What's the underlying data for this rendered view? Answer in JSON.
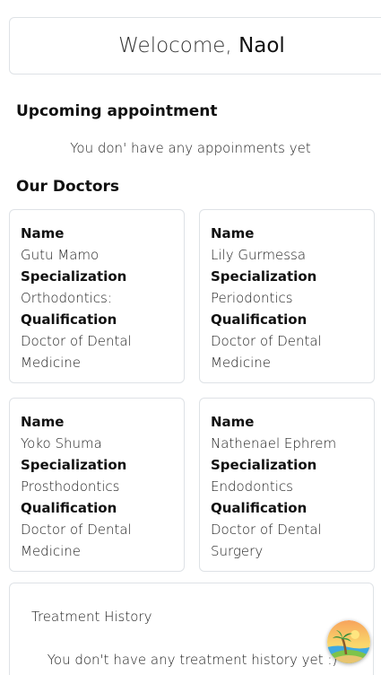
{
  "welcome": {
    "prefix": "Welocome,",
    "name": "Naol"
  },
  "appointments": {
    "heading": "Upcoming appointment",
    "empty_message": "You don' have any appoinments yet"
  },
  "doctors": {
    "heading": "Our Doctors",
    "labels": {
      "name": "Name",
      "specialization": "Specialization",
      "qualification": "Qualification"
    },
    "items": [
      {
        "name": "Gutu Mamo",
        "specialization": "Orthodontics:",
        "qualification_line1": "Doctor of Dental",
        "qualification_line2": "Medicine"
      },
      {
        "name": "Lily Gurmessa",
        "specialization": "Periodontics",
        "qualification_line1": "Doctor of Dental",
        "qualification_line2": "Medicine"
      },
      {
        "name": "Yoko Shuma",
        "specialization": "Prosthodontics",
        "qualification_line1": "Doctor of Dental",
        "qualification_line2": "Medicine"
      },
      {
        "name": "Nathenael Ephrem",
        "specialization": "Endodontics",
        "qualification_line1": "Doctor of Dental",
        "qualification_line2": "Surgery"
      }
    ]
  },
  "treatment_history": {
    "title": "Treatment History",
    "empty_message": "You don't have any treatment history yet :)"
  },
  "fab": {
    "icon": "beach-island-icon"
  },
  "colors": {
    "border": "#dee2e6",
    "text": "#222222"
  }
}
